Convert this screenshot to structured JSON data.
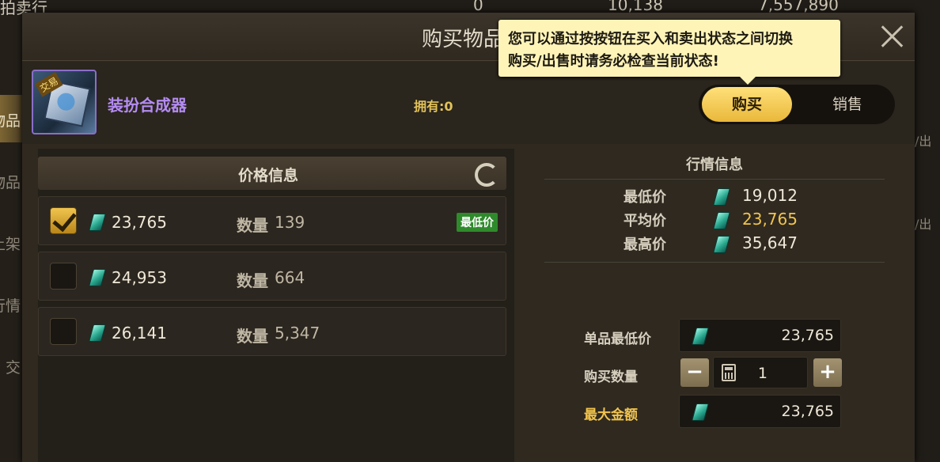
{
  "topbar": {
    "left_label": "拍卖行",
    "currency1_value": "0",
    "currency2_value": "10,138",
    "currency3_value": "7,557,890"
  },
  "leftnav": {
    "items": [
      {
        "label": "物品"
      },
      {
        "label": "物品"
      },
      {
        "label": "上架"
      },
      {
        "label": "行情"
      },
      {
        "label": "交"
      }
    ]
  },
  "rightside": {
    "items": [
      {
        "label": "/出"
      },
      {
        "label": "/出"
      }
    ]
  },
  "modal": {
    "title": "购买物品"
  },
  "item": {
    "name": "装扮合成器",
    "tag": "交易",
    "owned": "拥有:0"
  },
  "mode_toggle": {
    "buy_label": "购买",
    "sell_label": "销售",
    "selected": "购买"
  },
  "tooltip": {
    "line1": "您可以通过按按钮在买入和卖出状态之间切换",
    "line2": "购买/出售时请务必检查当前状态!"
  },
  "price_panel": {
    "title": "价格信息",
    "qty_label": "数量",
    "rows": [
      {
        "price": "23,765",
        "qty": "139",
        "checked": true,
        "badge": "最低价"
      },
      {
        "price": "24,953",
        "qty": "664",
        "checked": false,
        "badge": ""
      },
      {
        "price": "26,141",
        "qty": "5,347",
        "checked": false,
        "badge": ""
      }
    ]
  },
  "market": {
    "title": "行情信息",
    "rows": [
      {
        "label": "最低价",
        "value": "19,012"
      },
      {
        "label": "平均价",
        "value": "23,765"
      },
      {
        "label": "最高价",
        "value": "35,647"
      }
    ]
  },
  "purchase_form": {
    "unit_price_label": "单品最低价",
    "unit_price_value": "23,765",
    "quantity_label": "购买数量",
    "quantity_value": "1",
    "minus": "−",
    "plus": "+",
    "max_amount_label": "最大金额",
    "max_amount_value": "23,765"
  },
  "colors": {
    "accent_gold": "#f1c44e",
    "item_name_purple": "#b48cf2",
    "badge_green": "#2f8a2c",
    "tooltip_bg": "#fff4b8"
  }
}
